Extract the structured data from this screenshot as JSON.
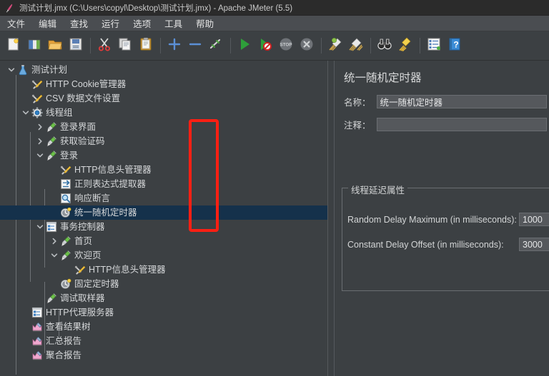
{
  "window": {
    "title": "测试计划.jmx (C:\\Users\\copyl\\Desktop\\测试计划.jmx) - Apache JMeter (5.5)",
    "icon": "jmeter-feather-icon"
  },
  "menu": {
    "items": [
      {
        "label": "文件",
        "name": "menu-file"
      },
      {
        "label": "编辑",
        "name": "menu-edit"
      },
      {
        "label": "查找",
        "name": "menu-search"
      },
      {
        "label": "运行",
        "name": "menu-run"
      },
      {
        "label": "选项",
        "name": "menu-options"
      },
      {
        "label": "工具",
        "name": "menu-tools"
      },
      {
        "label": "帮助",
        "name": "menu-help"
      }
    ]
  },
  "toolbar": {
    "buttons": [
      {
        "icon": "new-document-icon",
        "name": "toolbar-new"
      },
      {
        "icon": "templates-icon",
        "name": "toolbar-templates"
      },
      {
        "icon": "open-folder-icon",
        "name": "toolbar-open"
      },
      {
        "icon": "save-floppy-icon",
        "name": "toolbar-save"
      },
      {
        "sep": true
      },
      {
        "icon": "cut-scissors-icon",
        "name": "toolbar-cut"
      },
      {
        "icon": "copy-icon",
        "name": "toolbar-copy"
      },
      {
        "icon": "paste-clipboard-icon",
        "name": "toolbar-paste"
      },
      {
        "sep": true
      },
      {
        "icon": "plus-expand-icon",
        "name": "toolbar-expand-all"
      },
      {
        "icon": "minus-collapse-icon",
        "name": "toolbar-collapse-all"
      },
      {
        "icon": "toggle-enable-icon",
        "name": "toolbar-toggle"
      },
      {
        "sep": true
      },
      {
        "icon": "start-play-icon",
        "name": "toolbar-start"
      },
      {
        "icon": "start-no-timers-icon",
        "name": "toolbar-start-no-pauses"
      },
      {
        "icon": "stop-icon",
        "name": "toolbar-stop"
      },
      {
        "icon": "shutdown-icon",
        "name": "toolbar-shutdown"
      },
      {
        "sep": true
      },
      {
        "icon": "clear-broom-icon",
        "name": "toolbar-clear"
      },
      {
        "icon": "clear-all-broom-icon",
        "name": "toolbar-clear-all"
      },
      {
        "sep": true
      },
      {
        "icon": "binoculars-search-icon",
        "name": "toolbar-search"
      },
      {
        "icon": "reset-search-broom-icon",
        "name": "toolbar-reset-search"
      },
      {
        "sep": true
      },
      {
        "icon": "function-helper-icon",
        "name": "toolbar-function-helper"
      },
      {
        "icon": "help-book-icon",
        "name": "toolbar-help"
      }
    ]
  },
  "tree": {
    "nodes": [
      {
        "label": "测试计划",
        "icon": "test-plan-icon",
        "depth": 0,
        "toggle": "down",
        "selected": false
      },
      {
        "label": "HTTP Cookie管理器",
        "icon": "config-tools-icon",
        "depth": 1,
        "toggle": "none",
        "selected": false
      },
      {
        "label": "CSV 数据文件设置",
        "icon": "config-tools-icon",
        "depth": 1,
        "toggle": "none",
        "selected": false
      },
      {
        "label": "线程组",
        "icon": "thread-group-gear-icon",
        "depth": 1,
        "toggle": "down",
        "selected": false
      },
      {
        "label": "登录界面",
        "icon": "http-sampler-icon",
        "depth": 2,
        "toggle": "right",
        "selected": false
      },
      {
        "label": "获取验证码",
        "icon": "http-sampler-icon",
        "depth": 2,
        "toggle": "right",
        "selected": false
      },
      {
        "label": "登录",
        "icon": "http-sampler-icon",
        "depth": 2,
        "toggle": "down",
        "selected": false
      },
      {
        "label": "HTTP信息头管理器",
        "icon": "config-tools-icon",
        "depth": 3,
        "toggle": "none",
        "selected": false
      },
      {
        "label": "正则表达式提取器",
        "icon": "post-processor-icon",
        "depth": 3,
        "toggle": "none",
        "selected": false
      },
      {
        "label": "响应断言",
        "icon": "assertion-magnifier-icon",
        "depth": 3,
        "toggle": "none",
        "selected": false
      },
      {
        "label": "统一随机定时器",
        "icon": "timer-clock-icon",
        "depth": 3,
        "toggle": "none",
        "selected": true
      },
      {
        "label": "事务控制器",
        "icon": "controller-icon",
        "depth": 2,
        "toggle": "down",
        "selected": false
      },
      {
        "label": "首页",
        "icon": "http-sampler-icon",
        "depth": 3,
        "toggle": "right",
        "selected": false
      },
      {
        "label": "欢迎页",
        "icon": "http-sampler-icon",
        "depth": 3,
        "toggle": "down",
        "selected": false
      },
      {
        "label": "HTTP信息头管理器",
        "icon": "config-tools-icon",
        "depth": 4,
        "toggle": "none",
        "selected": false
      },
      {
        "label": "固定定时器",
        "icon": "timer-clock-icon",
        "depth": 3,
        "toggle": "none",
        "selected": false
      },
      {
        "label": "调试取样器",
        "icon": "http-sampler-icon",
        "depth": 2,
        "toggle": "none",
        "selected": false
      },
      {
        "label": "HTTP代理服务器",
        "icon": "controller-icon",
        "depth": 1,
        "toggle": "none",
        "selected": false
      },
      {
        "label": "查看结果树",
        "icon": "listener-chart-icon",
        "depth": 1,
        "toggle": "none",
        "selected": false
      },
      {
        "label": "汇总报告",
        "icon": "listener-chart-icon",
        "depth": 1,
        "toggle": "none",
        "selected": false
      },
      {
        "label": "聚合报告",
        "icon": "listener-chart-icon",
        "depth": 1,
        "toggle": "none",
        "selected": false
      }
    ]
  },
  "editor": {
    "title": "统一随机定时器",
    "name_label": "名称：",
    "name_value": "统一随机定时器",
    "comment_label": "注释：",
    "comment_value": "",
    "group_title": "线程延迟属性",
    "fields": [
      {
        "label": "Random Delay Maximum (in milliseconds):",
        "value": "1000",
        "name": "random-delay-maximum-input"
      },
      {
        "label": "Constant Delay Offset (in milliseconds):",
        "value": "3000",
        "name": "constant-delay-offset-input"
      }
    ]
  },
  "annotation": {
    "color": "#ff1f13",
    "shape": "rectangle",
    "label": "highlight-delay-values"
  }
}
